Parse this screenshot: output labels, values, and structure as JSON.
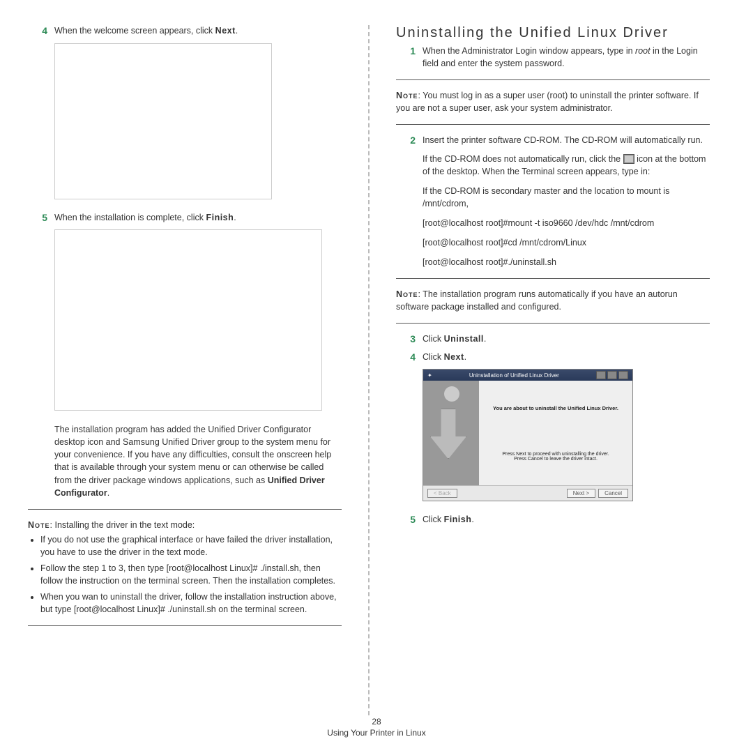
{
  "left": {
    "step4": {
      "num": "4",
      "text_a": "When the welcome screen appears, click ",
      "bold": "Next",
      "text_b": "."
    },
    "step5": {
      "num": "5",
      "text_a": "When the installation is complete, click ",
      "bold": "Finish",
      "text_b": "."
    },
    "added_para_a": "The installation program has added the Unified Driver Configurator desktop icon and Samsung Unified Driver group to the system menu for your convenience. If you have any difficulties, consult the onscreen help that is available through your system menu or can otherwise be called from the driver package windows applications, such as ",
    "added_para_bold": "Unified Driver Configurator",
    "added_para_b": ".",
    "note_label": "Note",
    "note_lead": ": Installing the driver in the text mode:",
    "bullets": [
      "If you do not use the graphical interface or have failed the driver installation, you have to use the driver in the text mode.",
      "Follow the step 1 to 3, then type [root@localhost Linux]# ./install.sh, then follow the instruction on the terminal screen. Then the installation completes.",
      "When you wan to uninstall the driver, follow the installation instruction above, but type [root@localhost Linux]# ./uninstall.sh on the terminal screen."
    ]
  },
  "right": {
    "heading": "Uninstalling the Unified Linux Driver",
    "step1": {
      "num": "1",
      "text_a": "When the Administrator Login window appears, type in ",
      "italic": "root",
      "text_b": " in the Login field and enter the system password."
    },
    "note1_label": "Note",
    "note1_text": ": You must log in as a super user (root) to uninstall the printer software. If you are not a super user, ask your system administrator.",
    "step2": {
      "num": "2",
      "text": "Insert the printer software CD-ROM. The CD-ROM will automatically run."
    },
    "p_autorun_a": "If the CD-ROM does not automatically run, click the ",
    "p_autorun_b": " icon at the bottom of the desktop. When the Terminal screen appears, type in:",
    "p_secondary": "If the CD-ROM is secondary master and the location to mount is /mnt/cdrom,",
    "cmd1": "[root@localhost root]#mount -t iso9660 /dev/hdc /mnt/cdrom",
    "cmd2": "[root@localhost root]#cd /mnt/cdrom/Linux",
    "cmd3": "[root@localhost root]#./uninstall.sh",
    "note2_label": "Note",
    "note2_text": ": The installation program runs automatically if you have an autorun software package installed and configured.",
    "step3": {
      "num": "3",
      "text_a": "Click ",
      "bold": "Uninstall",
      "text_b": "."
    },
    "step4": {
      "num": "4",
      "text_a": "Click ",
      "bold": "Next",
      "text_b": "."
    },
    "dialog": {
      "title": "Uninstallation of Unified Linux Driver",
      "msg1": "You are about to uninstall the Unified Linux Driver.",
      "msg2a": "Press Next to proceed with uninstalling the driver.",
      "msg2b": "Press Cancel to leave the driver intact.",
      "btn_back": "< Back",
      "btn_next": "Next >",
      "btn_cancel": "Cancel"
    },
    "step5": {
      "num": "5",
      "text_a": "Click ",
      "bold": "Finish",
      "text_b": "."
    }
  },
  "footer": {
    "page": "28",
    "caption": "Using Your Printer in Linux"
  }
}
